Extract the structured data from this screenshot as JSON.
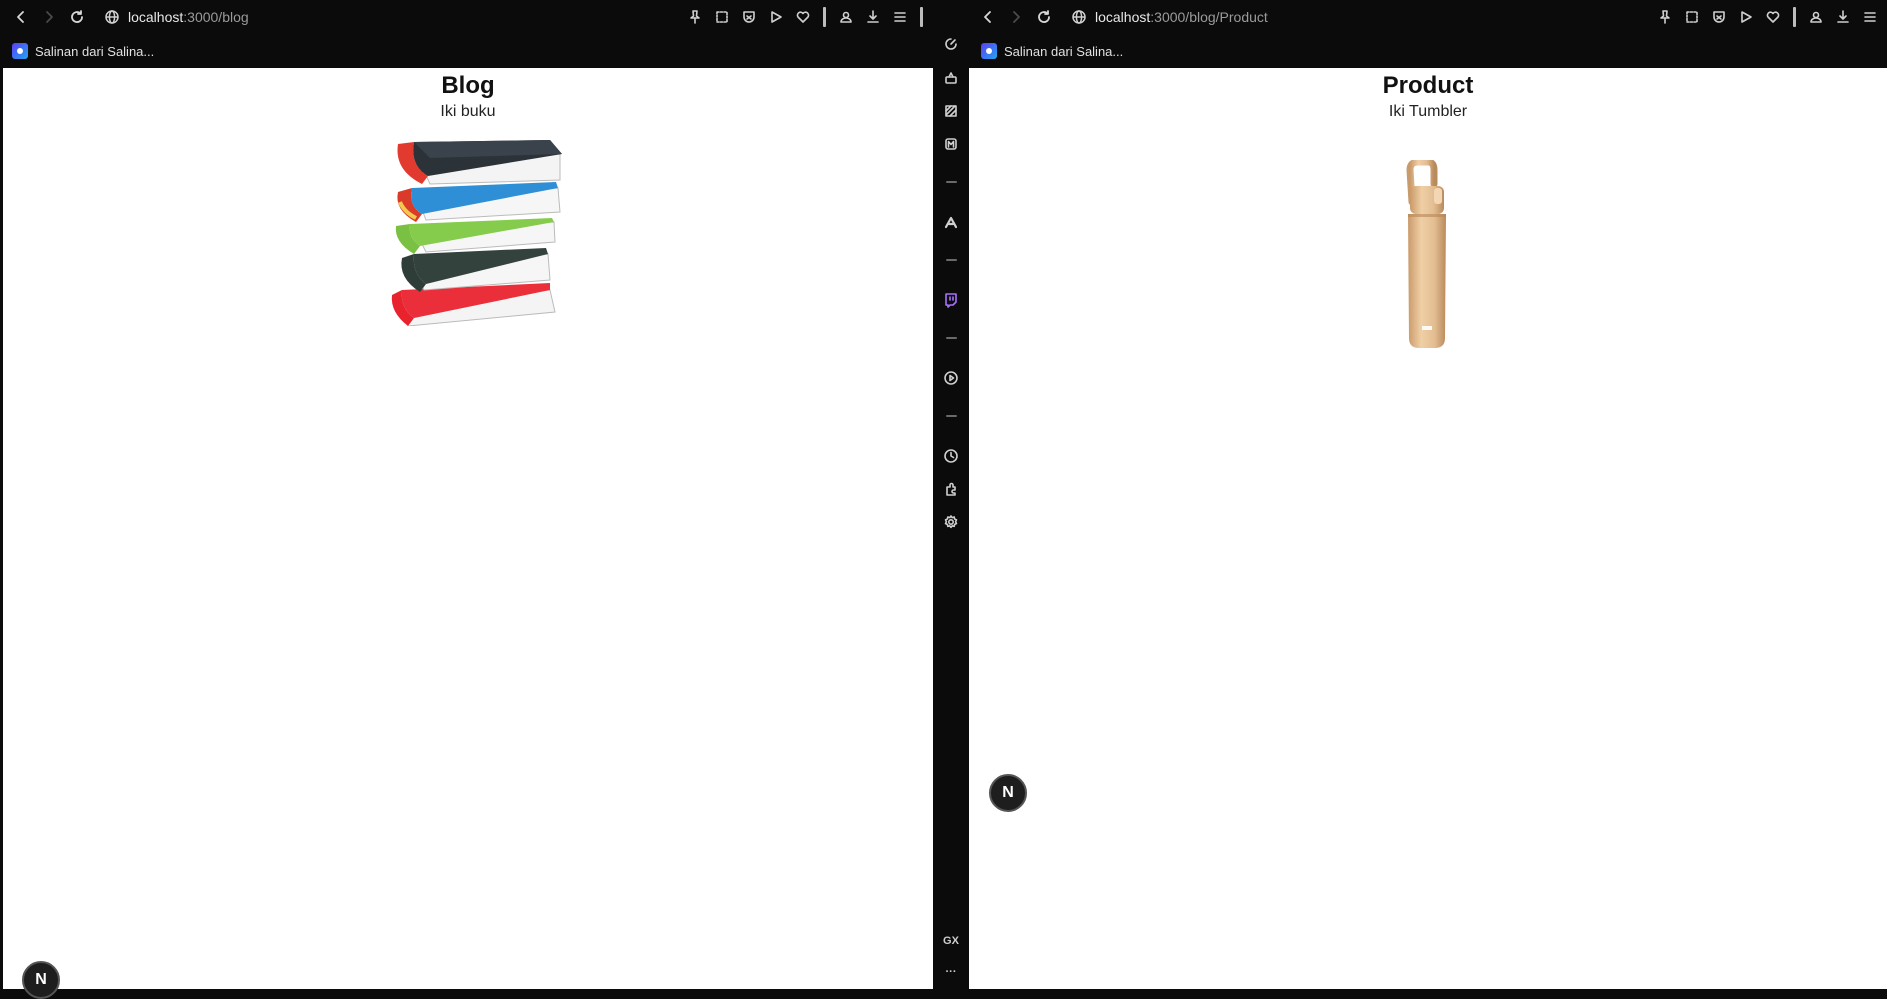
{
  "left": {
    "url_host": "localhost",
    "url_path": ":3000/blog",
    "bookmark_label": "Salinan dari Salina...",
    "page_title": "Blog",
    "page_subtitle": "Iki buku",
    "image_alt": "stack of books",
    "next_badge": "N"
  },
  "right": {
    "url_host": "localhost",
    "url_path": ":3000/blog/Product",
    "bookmark_label": "Salinan dari Salina...",
    "page_title": "Product",
    "page_subtitle": "Iki Tumbler",
    "image_alt": "tumbler bottle",
    "next_badge": "N"
  },
  "sidebar": {
    "gx_label": "GX",
    "more_label": "···"
  },
  "colors": {
    "chrome_bg": "#0b0b0b",
    "page_bg": "#ffffff",
    "tumbler": "#e3bd92"
  }
}
